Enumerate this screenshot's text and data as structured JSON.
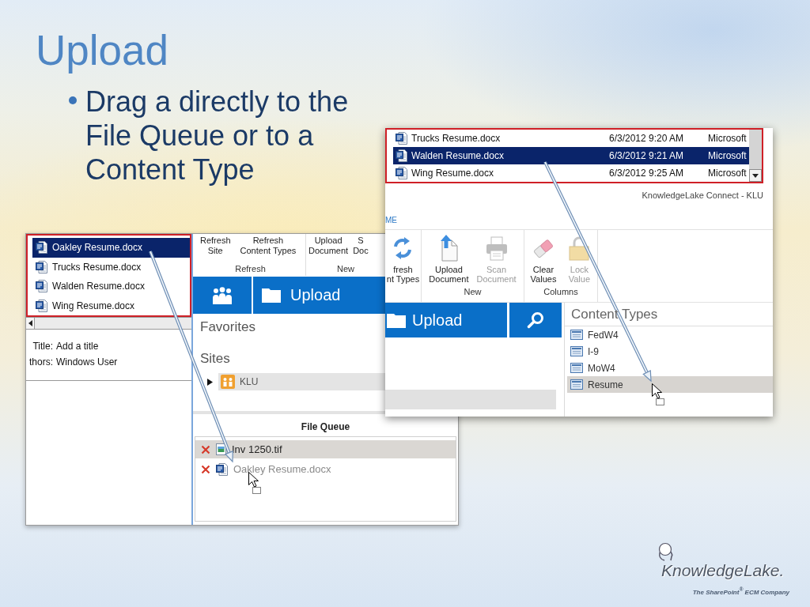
{
  "slide": {
    "title": "Upload",
    "bullets": [
      "Drag a directly to the File Queue or to a Content Type"
    ]
  },
  "left_window": {
    "explorer_files": [
      {
        "name": "Oakley Resume.docx",
        "selected": true
      },
      {
        "name": "Trucks Resume.docx",
        "selected": false
      },
      {
        "name": "Walden Resume.docx",
        "selected": false
      },
      {
        "name": "Wing Resume.docx",
        "selected": false
      }
    ],
    "details": [
      {
        "label": "Title:",
        "value": "Add a title"
      },
      {
        "label": "thors:",
        "value": "Windows User"
      }
    ],
    "ribbon_groups": [
      {
        "label": "Refresh",
        "buttons": [
          {
            "lines": [
              "Refresh",
              "Site"
            ],
            "disabled": false
          },
          {
            "lines": [
              "Refresh",
              "Content Types"
            ],
            "disabled": false
          }
        ]
      },
      {
        "label": "New",
        "buttons": [
          {
            "lines": [
              "Upload",
              "Document"
            ],
            "disabled": false
          },
          {
            "lines": [
              "S",
              "Doc"
            ],
            "disabled": false
          }
        ]
      }
    ],
    "nav_tiles": [
      {
        "kind": "people"
      },
      {
        "kind": "folder",
        "label": "Upload"
      }
    ],
    "favorites_heading": "Favorites",
    "sites_heading": "Sites",
    "sites": [
      {
        "name": "KLU",
        "expanded": false
      }
    ],
    "file_queue": {
      "title": "File Queue",
      "items": [
        {
          "name": "Inv 1250.tif",
          "kind": "image",
          "selected": true,
          "dimmed": false
        },
        {
          "name": "Oakley Resume.docx",
          "kind": "document",
          "selected": false,
          "dimmed": true
        }
      ]
    }
  },
  "right_window": {
    "explorer_files": [
      {
        "name": "Trucks Resume.docx",
        "modified": "6/3/2012 9:20 AM",
        "type": "Microsoft",
        "selected": false
      },
      {
        "name": "Walden Resume.docx",
        "modified": "6/3/2012 9:21 AM",
        "type": "Microsoft",
        "selected": true
      },
      {
        "name": "Wing Resume.docx",
        "modified": "6/3/2012 9:25 AM",
        "type": "Microsoft",
        "selected": false
      }
    ],
    "app_title": "KnowledgeLake Connect - KLU",
    "tab": "ME",
    "ribbon_groups": [
      {
        "buttons": [
          {
            "kind": "refresh",
            "lines": [
              "fresh",
              "nt Types"
            ],
            "disabled": false
          }
        ]
      },
      {
        "label": "New",
        "buttons": [
          {
            "kind": "upload",
            "lines": [
              "Upload",
              "Document"
            ],
            "disabled": false
          },
          {
            "kind": "scan",
            "lines": [
              "Scan",
              "Document"
            ],
            "disabled": true
          }
        ]
      },
      {
        "label": "Columns",
        "buttons": [
          {
            "kind": "clear",
            "lines": [
              "Clear",
              "Values"
            ],
            "disabled": false
          },
          {
            "kind": "lock",
            "lines": [
              "Lock",
              "Value"
            ],
            "disabled": true
          }
        ]
      }
    ],
    "nav_tiles": [
      {
        "kind": "folder",
        "label": "Upload"
      },
      {
        "kind": "search"
      }
    ],
    "content_types_heading": "Content Types",
    "content_types": [
      {
        "name": "FedW4",
        "selected": false
      },
      {
        "name": "I-9",
        "selected": false
      },
      {
        "name": "MoW4",
        "selected": false
      },
      {
        "name": "Resume",
        "selected": true
      }
    ]
  },
  "logo": {
    "wordmark": "KnowledgeLake.",
    "tagline": "The SharePoint$^{®}$ ECM Company"
  }
}
